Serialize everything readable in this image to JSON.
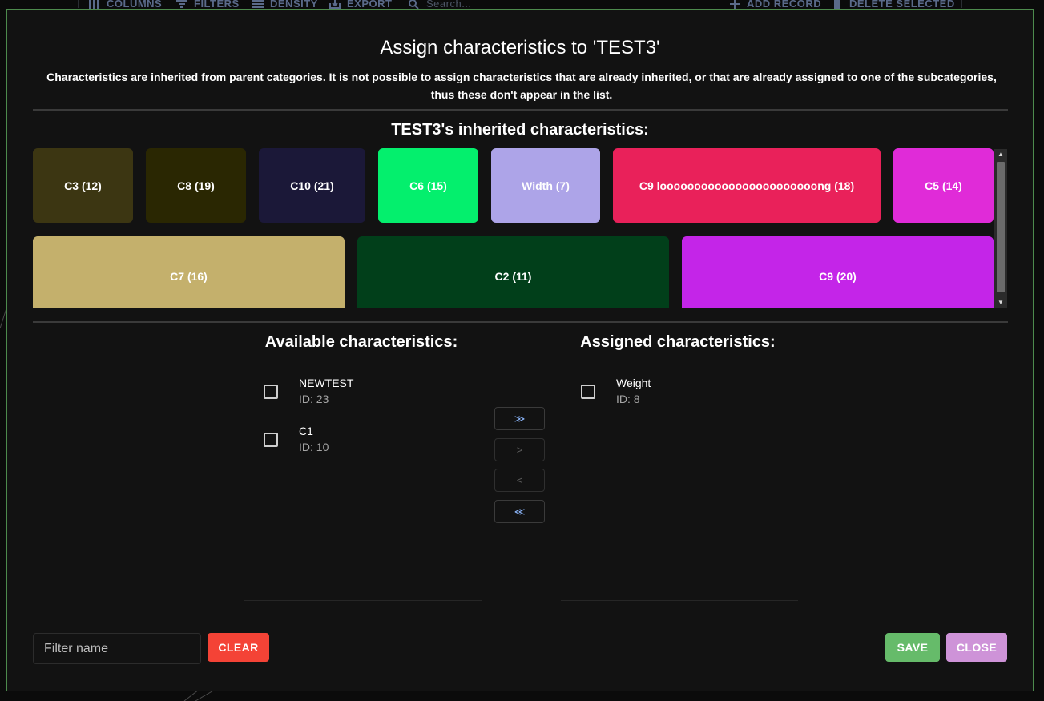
{
  "background": {
    "toolbar": [
      {
        "icon": "columns-icon",
        "label": "COLUMNS"
      },
      {
        "icon": "filter-icon",
        "label": "FILTERS"
      },
      {
        "icon": "density-icon",
        "label": "DENSITY"
      },
      {
        "icon": "export-icon",
        "label": "EXPORT"
      },
      {
        "icon": "search-icon",
        "label": "Search..."
      },
      {
        "icon": "plus-icon",
        "label": "ADD RECORD"
      },
      {
        "icon": "trash-icon",
        "label": "DELETE SELECTED"
      }
    ]
  },
  "dialog": {
    "title": "Assign characteristics to 'TEST3'",
    "subtitle": "Characteristics are inherited from parent categories. It is not possible to assign characteristics that are already inherited, or that are already assigned to one of the subcategories, thus these don't appear in the list.",
    "inherited_title": "TEST3's inherited characteristics:",
    "inherited": [
      {
        "label": "C3 (12)",
        "color": "#3c3612"
      },
      {
        "label": "C8 (19)",
        "color": "#2a2702"
      },
      {
        "label": "C10 (21)",
        "color": "#1b1838"
      },
      {
        "label": "C6 (15)",
        "color": "#04ef6d"
      },
      {
        "label": "Width (7)",
        "color": "#ada4e8"
      },
      {
        "label": "C9 looooooooooooooooooooooong (18)",
        "color": "#e9215a"
      },
      {
        "label": "C5 (14)",
        "color": "#e02bd8"
      },
      {
        "label": "C7 (16)",
        "color": "#c4b06c"
      },
      {
        "label": "C2 (11)",
        "color": "#013f1a"
      },
      {
        "label": "C9 (20)",
        "color": "#c425e8"
      }
    ],
    "available_title": "Available characteristics:",
    "available": [
      {
        "name": "NEWTEST",
        "id": "ID: 23"
      },
      {
        "name": "C1",
        "id": "ID: 10"
      }
    ],
    "assigned_title": "Assigned characteristics:",
    "assigned": [
      {
        "name": "Weight",
        "id": "ID: 8"
      }
    ],
    "move_buttons": [
      "≫",
      ">",
      "<",
      "≪"
    ],
    "filter_placeholder": "Filter name",
    "clear_label": "CLEAR",
    "save_label": "SAVE",
    "close_label": "CLOSE",
    "colors": {
      "clear": "#f44336",
      "save": "#66bb6a",
      "close": "#ce93d8",
      "dialog_border": "#4d8a4d"
    }
  }
}
